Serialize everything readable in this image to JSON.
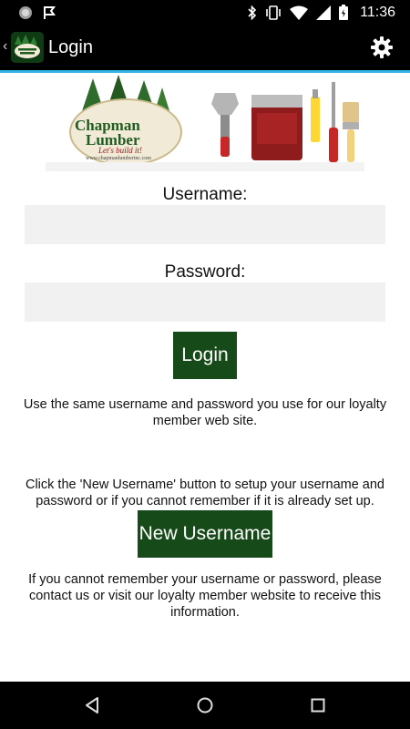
{
  "status_bar": {
    "time": "11:36",
    "left_icons": [
      "circle-notification-icon",
      "flag-notification-icon"
    ],
    "right_icons": [
      "bluetooth-icon",
      "vibrate-icon",
      "wifi-icon",
      "signal-icon",
      "battery-icon"
    ]
  },
  "app_bar": {
    "title": "Login",
    "icons": [
      "back-chevron-icon",
      "app-logo-icon",
      "gear-icon"
    ]
  },
  "banner": {
    "logo_line1": "Chapman",
    "logo_line2": "Lumber",
    "tagline": "Let's build it!",
    "url": "www.chapmanlumberinc.com"
  },
  "form": {
    "username_label": "Username:",
    "username_value": "",
    "password_label": "Password:",
    "password_value": "",
    "login_button": "Login"
  },
  "info": {
    "text1": "Use the same username and password you use for our loyalty member web site.",
    "text2": "Click the 'New Username' button to setup your username and password or if you cannot remember if it is already set up.",
    "new_username_button": "New Username",
    "text3": "If you cannot remember your username or password, please contact us or visit our loyalty member website to receive this information."
  },
  "nav_bar": {
    "icons": [
      "back-triangle-icon",
      "home-circle-icon",
      "recents-square-icon"
    ]
  },
  "colors": {
    "accent_line": "#33b5e5",
    "button_green": "#174a19",
    "input_bg": "#f1f1f1"
  }
}
